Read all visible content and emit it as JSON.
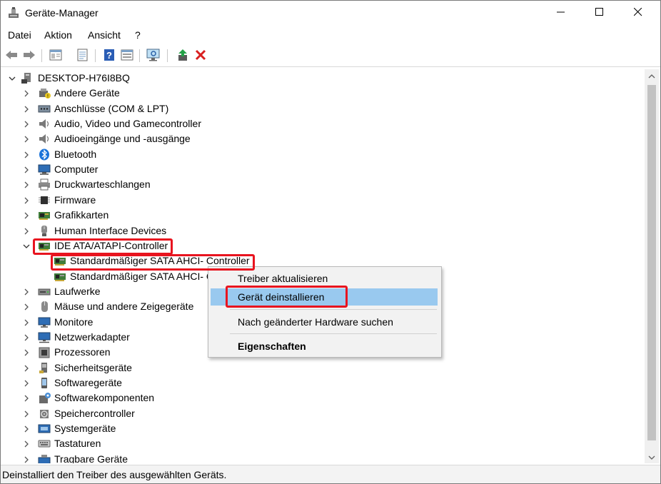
{
  "window": {
    "title": "Geräte-Manager"
  },
  "titlebar_icons": [
    "minimize-icon",
    "maximize-icon",
    "close-icon"
  ],
  "menu": [
    "Datei",
    "Aktion",
    "Ansicht",
    "?"
  ],
  "toolbar_icons": [
    "back-arrow-icon",
    "forward-arrow-icon",
    "properties-icon",
    "driver-details-icon",
    "help-icon",
    "view-icon",
    "monitor-scan-icon",
    "update-driver-icon",
    "uninstall-x-icon"
  ],
  "tree": {
    "root": "DESKTOP-H76I8BQ",
    "items": [
      {
        "label": "Andere Geräte",
        "icon": "unknown-device-icon"
      },
      {
        "label": "Anschlüsse (COM & LPT)",
        "icon": "port-icon"
      },
      {
        "label": "Audio, Video und Gamecontroller",
        "icon": "speaker-icon"
      },
      {
        "label": "Audioeingänge und -ausgänge",
        "icon": "speaker-icon"
      },
      {
        "label": "Bluetooth",
        "icon": "bluetooth-icon"
      },
      {
        "label": "Computer",
        "icon": "computer-icon"
      },
      {
        "label": "Druckwarteschlangen",
        "icon": "printer-icon"
      },
      {
        "label": "Firmware",
        "icon": "chip-icon"
      },
      {
        "label": "Grafikkarten",
        "icon": "display-adapter-icon"
      },
      {
        "label": "Human Interface Devices",
        "icon": "hid-icon"
      },
      {
        "label": "IDE ATA/ATAPI-Controller",
        "icon": "controller-icon",
        "expanded": true
      },
      {
        "label": "Standardmäßiger SATA AHCI- Controller",
        "icon": "controller-icon",
        "child": true
      },
      {
        "label": "Standardmäßiger SATA AHCI- C",
        "icon": "controller-icon",
        "child": true
      },
      {
        "label": "Laufwerke",
        "icon": "drive-icon"
      },
      {
        "label": "Mäuse und andere Zeigegeräte",
        "icon": "mouse-icon"
      },
      {
        "label": "Monitore",
        "icon": "monitor-icon"
      },
      {
        "label": "Netzwerkadapter",
        "icon": "network-icon"
      },
      {
        "label": "Prozessoren",
        "icon": "processor-icon"
      },
      {
        "label": "Sicherheitsgeräte",
        "icon": "security-icon"
      },
      {
        "label": "Softwaregeräte",
        "icon": "software-device-icon"
      },
      {
        "label": "Softwarekomponenten",
        "icon": "software-component-icon"
      },
      {
        "label": "Speichercontroller",
        "icon": "storage-controller-icon"
      },
      {
        "label": "Systemgeräte",
        "icon": "system-icon"
      },
      {
        "label": "Tastaturen",
        "icon": "keyboard-icon"
      },
      {
        "label": "Tragbare Geräte",
        "icon": "portable-device-icon"
      }
    ]
  },
  "context_menu": {
    "items": [
      "Treiber aktualisieren",
      "Gerät deinstallieren",
      "Nach geänderter Hardware suchen",
      "Eigenschaften"
    ],
    "highlighted": "Gerät deinstallieren"
  },
  "status": "Deinstalliert den Treiber des ausgewählten Geräts.",
  "colors": {
    "highlight": "#99c9ef",
    "annotation": "#e8141f"
  }
}
